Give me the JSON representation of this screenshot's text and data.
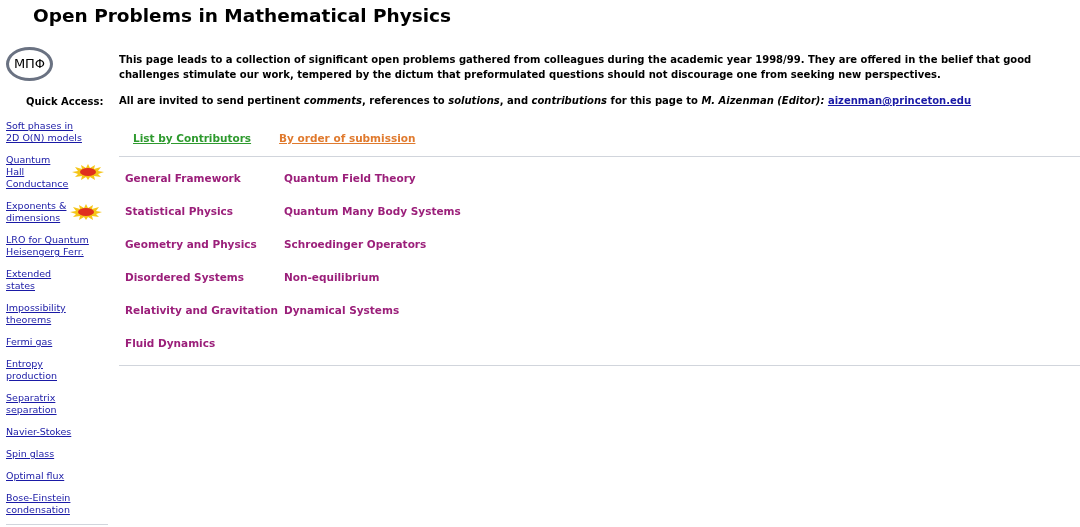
{
  "title": "Open Problems in Mathematical Physics",
  "logo": "MΠΦ",
  "quick_access": {
    "heading": "Quick Access:",
    "links": [
      {
        "text": "Soft phases in \n2D O(N) models",
        "new": false
      },
      {
        "text": "Quantum\nHall\nConductance",
        "new": true
      },
      {
        "text": "Exponents &\ndimensions",
        "new": true
      },
      {
        "text": "LRO for Quantum\nHeisengerg Ferr.",
        "new": false
      },
      {
        "text": "Extended\nstates",
        "new": false
      },
      {
        "text": "Impossibility\ntheorems",
        "new": false
      },
      {
        "text": "Fermi gas",
        "new": false
      },
      {
        "text": "Entropy\nproduction",
        "new": false
      },
      {
        "text": "Separatrix\nseparation",
        "new": false
      },
      {
        "text": "Navier-Stokes",
        "new": false
      },
      {
        "text": "Spin glass",
        "new": false
      },
      {
        "text": "Optimal flux",
        "new": false
      },
      {
        "text": "Bose-Einstein\ncondensation",
        "new": false
      }
    ]
  },
  "intro": "This page leads to a collection of significant open problems gathered from colleagues during the academic year 1998/99. They are offered in the belief that good challenges stimulate our work, tempered by the dictum that preformulated questions should not discourage one from seeking new perspectives.",
  "invitation": {
    "text": "All are invited to send pertinent *comments*, references to *solutions*, and *contributions* for this page to *M. Aizenman (Editor):*",
    "email": "aizenman@princeton.edu"
  },
  "index_links": [
    {
      "text": "List by Contributors",
      "color": "#2e9a2e"
    },
    {
      "text": "By order of submission",
      "color": "#e07a2e"
    }
  ],
  "topic_columns": [
    [
      "General Framework",
      "Statistical Physics",
      "Geometry and Physics",
      "Disordered Systems",
      "Relativity and Gravitation",
      "Fluid Dynamics"
    ],
    [
      "Quantum Field Theory",
      "Quantum Many Body Systems",
      "Schroedinger Operators",
      "Non-equilibrium",
      "Dynamical Systems"
    ]
  ]
}
